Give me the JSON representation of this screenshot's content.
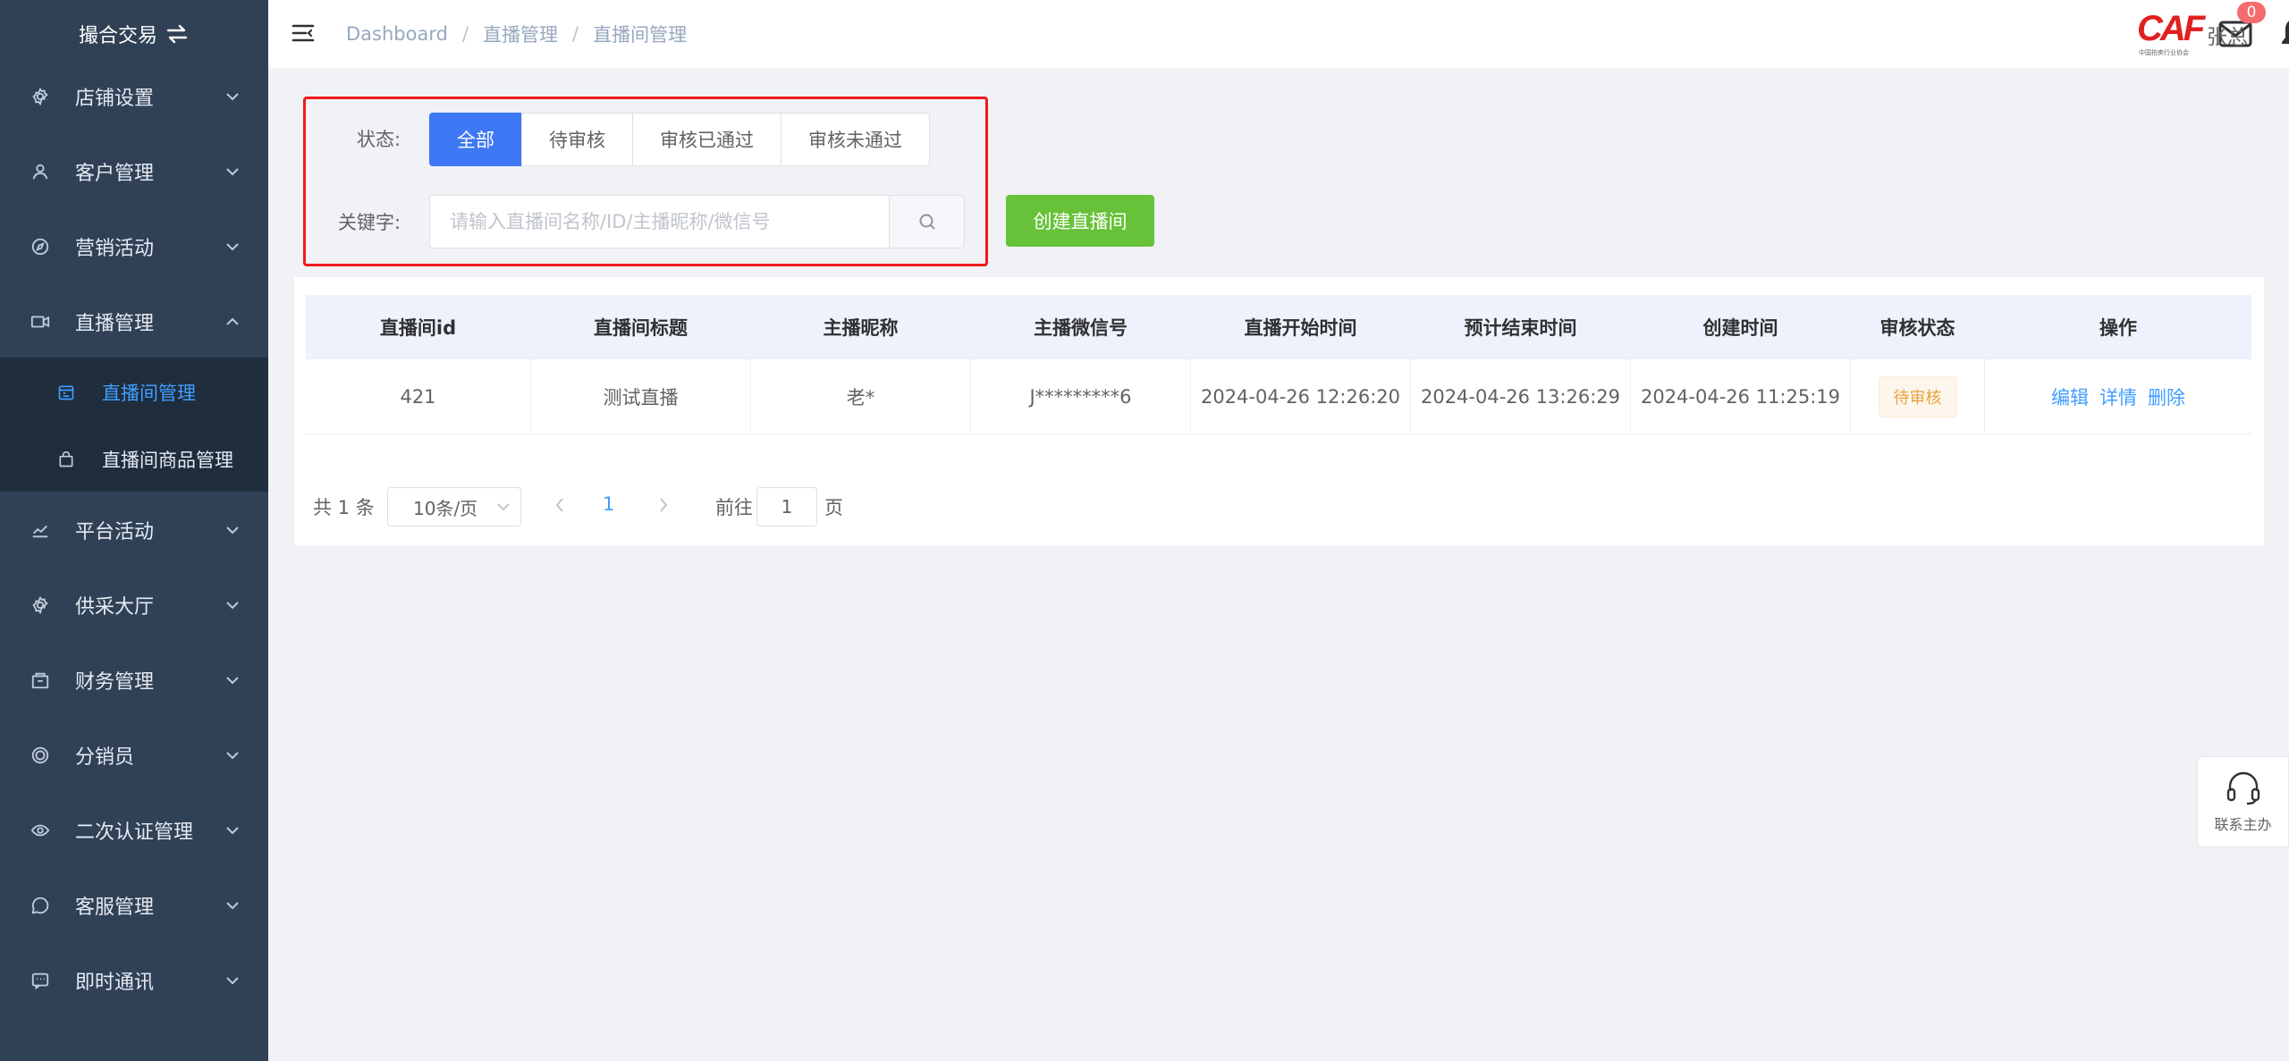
{
  "sidebar": {
    "brand": "撮合交易",
    "items": [
      {
        "label": "店铺设置",
        "icon": "gear-icon"
      },
      {
        "label": "客户管理",
        "icon": "user-icon"
      },
      {
        "label": "营销活动",
        "icon": "compass-icon"
      },
      {
        "label": "直播管理",
        "icon": "video-camera-icon"
      },
      {
        "label": "平台活动",
        "icon": "chart-line-icon"
      },
      {
        "label": "供采大厅",
        "icon": "gear-icon"
      },
      {
        "label": "财务管理",
        "icon": "wallet-icon"
      },
      {
        "label": "分销员",
        "icon": "coin-icon"
      },
      {
        "label": "二次认证管理",
        "icon": "eye-icon"
      },
      {
        "label": "客服管理",
        "icon": "chat-bubble-icon"
      },
      {
        "label": "即时通讯",
        "icon": "message-icon"
      }
    ],
    "submenu": [
      {
        "label": "直播间管理",
        "icon": "calendar-icon"
      },
      {
        "label": "直播间商品管理",
        "icon": "shopping-bag-icon"
      }
    ]
  },
  "header": {
    "breadcrumb": [
      "Dashboard",
      "直播管理",
      "直播间管理"
    ],
    "mail_badge": "0",
    "user_name": "张总",
    "logo_text": "CAF",
    "logo_caption": "中国拍卖行业协会"
  },
  "filter": {
    "status_label": "状态:",
    "status_options": [
      "全部",
      "待审核",
      "审核已通过",
      "审核未通过"
    ],
    "keyword_label": "关键字:",
    "search_placeholder": "请输入直播间名称/ID/主播昵称/微信号",
    "create_button": "创建直播间"
  },
  "table": {
    "columns": [
      "直播间id",
      "直播间标题",
      "主播昵称",
      "主播微信号",
      "直播开始时间",
      "预计结束时间",
      "创建时间",
      "审核状态",
      "操作"
    ],
    "rows": [
      {
        "id": "421",
        "title": "测试直播",
        "nickname": "老*",
        "wechat": "J*********6",
        "start_time": "2024-04-26 12:26:20",
        "end_time": "2024-04-26 13:26:29",
        "created_time": "2024-04-26 11:25:19",
        "status": "待审核",
        "actions": [
          "编辑",
          "详情",
          "删除"
        ]
      }
    ]
  },
  "pagination": {
    "total_text": "共 1 条",
    "page_size": "10条/页",
    "current_page": "1",
    "goto_label": "前往",
    "goto_value": "1",
    "goto_suffix": "页"
  },
  "contact": {
    "label": "联系主办"
  },
  "colors": {
    "sidebar_bg": "#304156",
    "primary": "#3e78f4",
    "success": "#67c23a",
    "warning": "#e6a23c",
    "danger_outline": "#f0191c"
  }
}
